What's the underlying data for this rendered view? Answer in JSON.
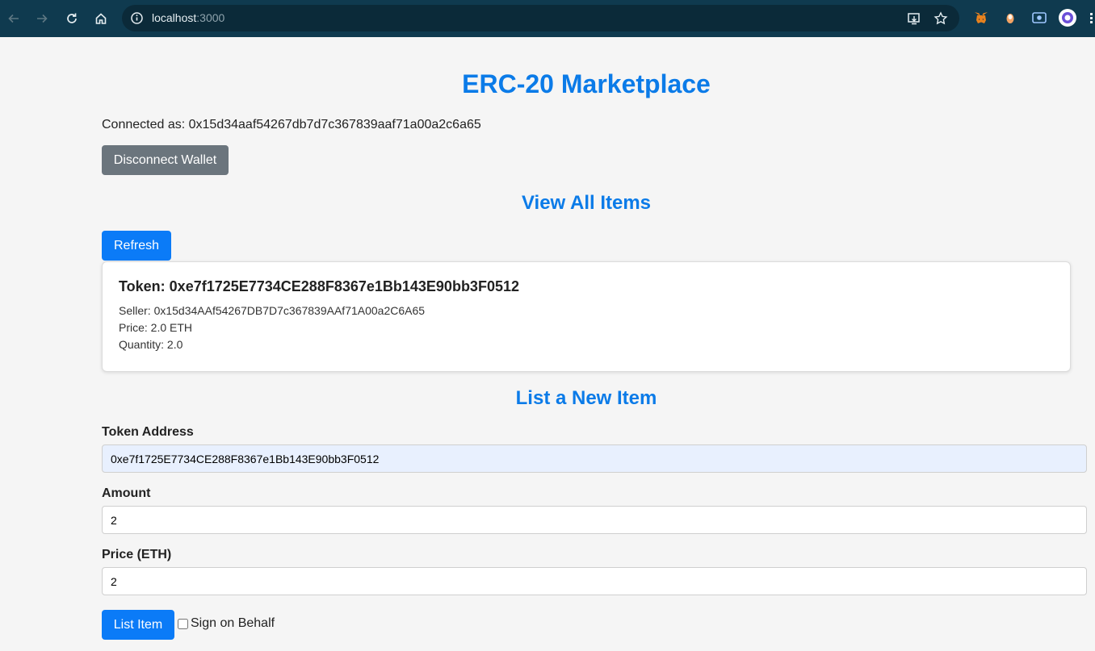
{
  "browser": {
    "url_host": "localhost",
    "url_port": ":3000"
  },
  "app": {
    "title": "ERC-20 Marketplace",
    "connected_as": "Connected as: 0x15d34aaf54267db7d7c367839aaf71a00a2c6a65",
    "disconnect_label": "Disconnect Wallet"
  },
  "view_items": {
    "heading": "View All Items",
    "refresh_label": "Refresh",
    "items": [
      {
        "token": "Token: 0xe7f1725E7734CE288F8367e1Bb143E90bb3F0512",
        "seller": "Seller: 0x15d34AAf54267DB7D7c367839AAf71A00a2C6A65",
        "price": "Price: 2.0 ETH",
        "quantity": "Quantity: 2.0"
      }
    ]
  },
  "list_item": {
    "heading": "List a New Item",
    "token_address_label": "Token Address",
    "token_address_value": "0xe7f1725E7734CE288F8367e1Bb143E90bb3F0512",
    "amount_label": "Amount",
    "amount_value": "2",
    "price_label": "Price (ETH)",
    "price_value": "2",
    "submit_label": "List Item",
    "sign_on_behalf_label": "Sign on Behalf",
    "sign_on_behalf_checked": false
  },
  "colors": {
    "accent": "#0b7be8",
    "button_blue": "#0b7bf7",
    "button_gray": "#6b757d",
    "chrome_bg": "#0f3a4f"
  },
  "icons": [
    "back-arrow-icon",
    "forward-arrow-icon",
    "reload-icon",
    "home-icon",
    "site-info-icon",
    "install-app-icon",
    "bookmark-star-icon",
    "metamask-extension-icon",
    "extension-icon",
    "screen-extension-icon",
    "profile-avatar-icon"
  ]
}
